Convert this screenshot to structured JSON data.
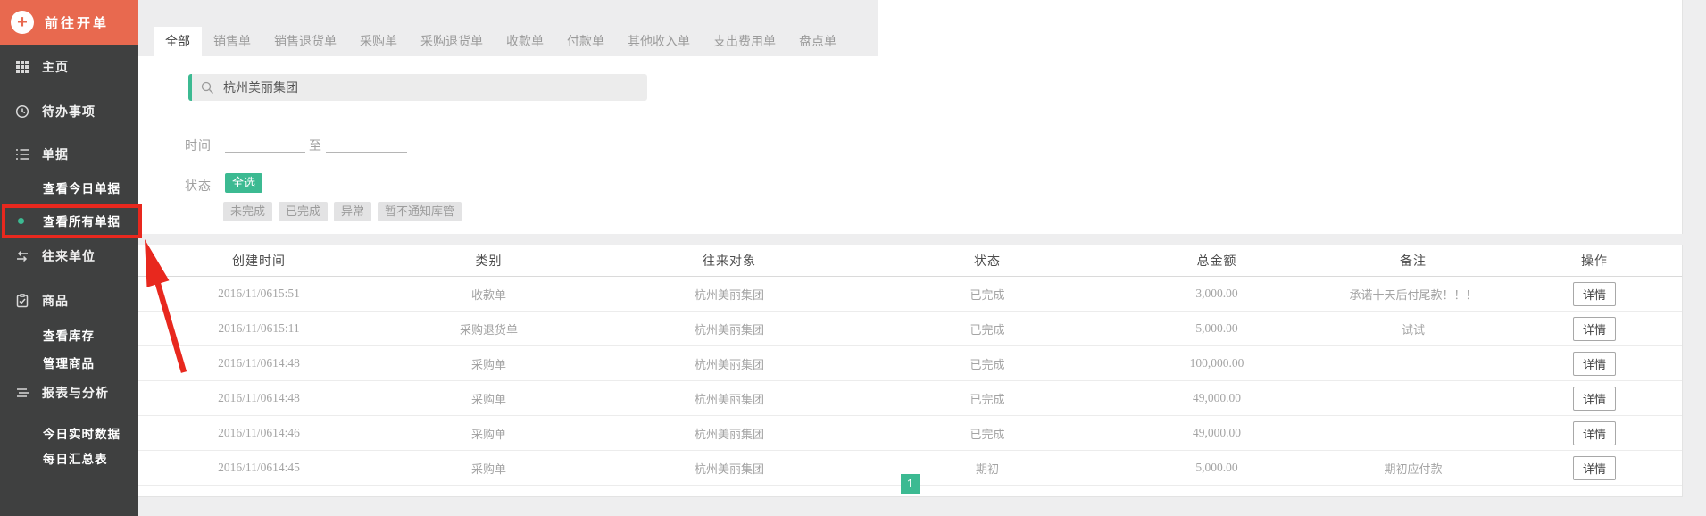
{
  "colors": {
    "accent_green": "#3cba92",
    "brand_orange": "#e8694f",
    "annotation_red": "#e8281e",
    "sidebar_bg": "#3f4040"
  },
  "sidebar": {
    "header": {
      "label": "前往开单"
    },
    "items": {
      "home": {
        "label": "主页"
      },
      "todo": {
        "label": "待办事项"
      },
      "orders": {
        "label": "单据"
      },
      "orders_today": {
        "label": "查看今日单据"
      },
      "orders_all": {
        "label": "查看所有单据"
      },
      "partners": {
        "label": "往来单位"
      },
      "goods": {
        "label": "商品"
      },
      "inventory": {
        "label": "查看库存"
      },
      "manage_goods": {
        "label": "管理商品"
      },
      "reports": {
        "label": "报表与分析"
      },
      "realtime": {
        "label": "今日实时数据"
      },
      "daily": {
        "label": "每日汇总表"
      }
    }
  },
  "tabs": [
    "全部",
    "销售单",
    "销售退货单",
    "采购单",
    "采购退货单",
    "收款单",
    "付款单",
    "其他收入单",
    "支出费用单",
    "盘点单"
  ],
  "filters": {
    "search_value": "杭州美丽集团",
    "time_label": "时间",
    "to_label": "至",
    "time_from": "",
    "time_to": "",
    "status_label": "状态",
    "select_all": "全选",
    "status_options": [
      "未完成",
      "已完成",
      "异常",
      "暂不通知库管"
    ]
  },
  "table": {
    "headers": [
      "创建时间",
      "类别",
      "往来对象",
      "状态",
      "总金额",
      "备注",
      "操作"
    ],
    "detail_label": "详情",
    "rows": [
      {
        "created": "2016/11/0615:51",
        "type": "收款单",
        "partner": "杭州美丽集团",
        "status": "已完成",
        "amount": "3,000.00",
        "remark": "承诺十天后付尾款！！！"
      },
      {
        "created": "2016/11/0615:11",
        "type": "采购退货单",
        "partner": "杭州美丽集团",
        "status": "已完成",
        "amount": "5,000.00",
        "remark": "试试"
      },
      {
        "created": "2016/11/0614:48",
        "type": "采购单",
        "partner": "杭州美丽集团",
        "status": "已完成",
        "amount": "100,000.00",
        "remark": ""
      },
      {
        "created": "2016/11/0614:48",
        "type": "采购单",
        "partner": "杭州美丽集团",
        "status": "已完成",
        "amount": "49,000.00",
        "remark": ""
      },
      {
        "created": "2016/11/0614:46",
        "type": "采购单",
        "partner": "杭州美丽集团",
        "status": "已完成",
        "amount": "49,000.00",
        "remark": ""
      },
      {
        "created": "2016/11/0614:45",
        "type": "采购单",
        "partner": "杭州美丽集团",
        "status": "期初",
        "amount": "5,000.00",
        "remark": "期初应付款"
      }
    ]
  },
  "pagination": {
    "current": "1"
  }
}
